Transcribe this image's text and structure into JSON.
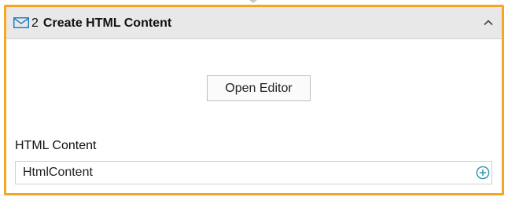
{
  "activity": {
    "step_number": "2",
    "title": "Create HTML Content",
    "icon": "envelope-icon",
    "collapse_icon": "chevron-up-icon"
  },
  "editor": {
    "button_label": "Open Editor"
  },
  "html_content_field": {
    "label": "HTML Content",
    "value": "HtmlContent",
    "add_icon": "plus-circle-icon"
  },
  "colors": {
    "selection_border": "#f5a623",
    "header_background": "#e8e8e8",
    "icon_accent": "#1e7fc2",
    "add_icon_color": "#2a8fa8"
  }
}
